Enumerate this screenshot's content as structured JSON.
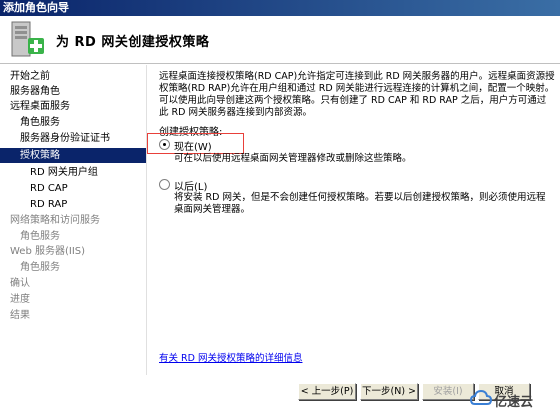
{
  "window": {
    "title": "添加角色向导"
  },
  "header": {
    "title": "为 RD 网关创建授权策略"
  },
  "sidebar": {
    "items": [
      {
        "label": "开始之前",
        "state": "normal"
      },
      {
        "label": "服务器角色",
        "state": "normal"
      },
      {
        "label": "远程桌面服务",
        "state": "normal"
      },
      {
        "label": "角色服务",
        "state": "normal"
      },
      {
        "label": "服务器身份验证证书",
        "state": "normal"
      },
      {
        "label": "授权策略",
        "state": "selected"
      },
      {
        "label": "RD 网关用户组",
        "state": "normal"
      },
      {
        "label": "RD CAP",
        "state": "normal"
      },
      {
        "label": "RD RAP",
        "state": "normal"
      },
      {
        "label": "网络策略和访问服务",
        "state": "disabled"
      },
      {
        "label": "角色服务",
        "state": "disabled"
      },
      {
        "label": "Web 服务器(IIS)",
        "state": "disabled"
      },
      {
        "label": "角色服务",
        "state": "disabled"
      },
      {
        "label": "确认",
        "state": "disabled"
      },
      {
        "label": "进度",
        "state": "disabled"
      },
      {
        "label": "结果",
        "state": "disabled"
      }
    ]
  },
  "main": {
    "description": "远程桌面连接授权策略(RD CAP)允许指定可连接到此 RD 网关服务器的用户。远程桌面资源授权策略(RD RAP)允许在用户组和通过 RD 网关能进行远程连接的计算机之间，配置一个映射。可以使用此向导创建这两个授权策略。只有创建了 RD CAP 和 RD RAP 之后，用户方可通过此 RD 网关服务器连接到内部资源。",
    "section_label": "创建授权策略:",
    "option_now": {
      "label": "现在(W)",
      "desc": "可在以后使用远程桌面网关管理器修改或删除这些策略。",
      "checked": true
    },
    "option_later": {
      "label": "以后(L)",
      "desc": "将安装 RD 网关，但是不会创建任何授权策略。若要以后创建授权策略，则必须使用远程桌面网关管理器。",
      "checked": false
    },
    "link": "有关 RD 网关授权策略的详细信息"
  },
  "footer": {
    "prev": "< 上一步(P)",
    "next": "下一步(N) >",
    "install": "安装(I)",
    "cancel": "取消"
  },
  "watermark": {
    "text": "亿速云"
  }
}
